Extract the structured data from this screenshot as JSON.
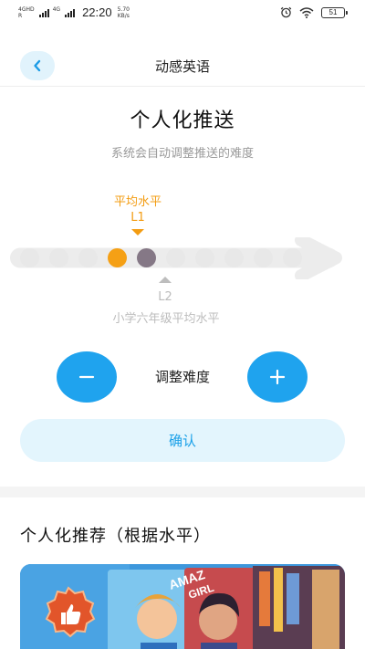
{
  "status_bar": {
    "net_top": "4GHD",
    "net_bottom": "R",
    "net2_top": "4G",
    "time": "22:20",
    "speed_value": "5.70",
    "speed_unit": "KB/s",
    "battery": "51"
  },
  "header": {
    "title": "动感英语",
    "back_icon": "chevron-left-icon"
  },
  "push": {
    "title": "个人化推送",
    "subtitle": "系统会自动调整推送的难度",
    "current_caption": "平均水平",
    "current_level": "L1",
    "target_level": "L2",
    "target_desc": "小学六年级平均水平",
    "adjust_label": "调整难度",
    "minus_icon": "minus-icon",
    "plus_icon": "plus-icon",
    "confirm_label": "确认",
    "track_dot_count": 10,
    "current_index": 4,
    "target_index": 5
  },
  "recommend": {
    "title": "个人化推荐（根据水平）",
    "card_badge_icon": "thumbs-up-icon",
    "book_title_fragment": "AMAZ GIRL"
  },
  "colors": {
    "accent_blue": "#1fa3ee",
    "light_blue": "#e3f5fd",
    "current_orange": "#f5a015",
    "target_purple": "#857886",
    "track_grey": "#e8e8e8"
  }
}
